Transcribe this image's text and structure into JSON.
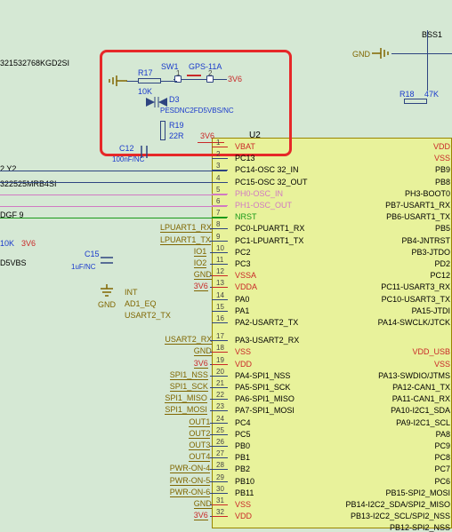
{
  "components": {
    "r17": {
      "ref": "R17",
      "value": "10K"
    },
    "r18": {
      "ref": "R18",
      "value": "47K"
    },
    "r19": {
      "ref": "R19",
      "value": "22R"
    },
    "r_left": {
      "value": "10K"
    },
    "c12": {
      "ref": "C12",
      "value": "100nF/NC"
    },
    "c15": {
      "ref": "C15",
      "value": "1uF/NC"
    },
    "d3": {
      "ref": "D3",
      "value": "PESDNC2FD5VBS/NC"
    },
    "sw1": {
      "ref": "SW1",
      "value": "GPS-11A"
    },
    "u2": {
      "ref": "U2"
    }
  },
  "partial_refs": {
    "top_left": "321532768KGD2SI",
    "y2": "2 Y2",
    "y2_part": "322525MRB4SI",
    "dgf9": "DGF  9",
    "d5vbs": "D5VBS",
    "bss": "BSS1"
  },
  "nets": {
    "gnd": "GND",
    "v3_6": "3V6",
    "int": "INT",
    "ad1_eq": "AD1_EQ",
    "nrst": "NRST"
  },
  "left_netlabels": {
    "lpuart1_rx": "LPUART1_RX",
    "lpuart1_tx": "LPUART1_TX",
    "io1": "IO1",
    "io2": "IO2",
    "usart2_tx": "USART2_TX",
    "usart2_rx": "USART2_RX",
    "spi1_nss": "SPI1_NSS",
    "spi1_sck": "SPI1_SCK",
    "spi1_miso": "SPI1_MISO",
    "spi1_mosi": "SPI1_MOSI",
    "out1": "OUT1",
    "out2": "OUT2",
    "out3": "OUT3",
    "out4": "OUT4",
    "pwr_on4": "PWR-ON-4",
    "pwr_on5": "PWR-ON-5",
    "pwr_on6": "PWR-ON-6"
  },
  "pins": [
    {
      "n": 1,
      "name": "VBAT",
      "cls": "red"
    },
    {
      "n": 2,
      "name": "PC13"
    },
    {
      "n": 3,
      "name": "PC14-OSC 32_IN"
    },
    {
      "n": 4,
      "name": "PC15-OSC 32_OUT"
    },
    {
      "n": 5,
      "name": "PH0-OSC_IN",
      "cls": "pink"
    },
    {
      "n": 6,
      "name": "PH1-OSC_OUT",
      "cls": "pink"
    },
    {
      "n": 7,
      "name": "NRST",
      "cls": "green"
    },
    {
      "n": 8,
      "name": "PC0-LPUART1_RX"
    },
    {
      "n": 9,
      "name": "PC1-LPUART1_TX"
    },
    {
      "n": 10,
      "name": "PC2"
    },
    {
      "n": 11,
      "name": "PC3"
    },
    {
      "n": 12,
      "name": "VSSA",
      "cls": "red"
    },
    {
      "n": 13,
      "name": "VDDA",
      "cls": "red"
    },
    {
      "n": 14,
      "name": "PA0"
    },
    {
      "n": 15,
      "name": "PA1"
    },
    {
      "n": 16,
      "name": "PA2-USART2_TX"
    },
    {
      "n": 17,
      "name": "PA3-USART2_RX"
    },
    {
      "n": 18,
      "name": "VSS",
      "cls": "red"
    },
    {
      "n": 19,
      "name": "VDD",
      "cls": "red"
    },
    {
      "n": 20,
      "name": "PA4-SPI1_NSS"
    },
    {
      "n": 21,
      "name": "PA5-SPI1_SCK"
    },
    {
      "n": 22,
      "name": "PA6-SPI1_MISO"
    },
    {
      "n": 23,
      "name": "PA7-SPI1_MOSI"
    },
    {
      "n": 24,
      "name": "PC4"
    },
    {
      "n": 25,
      "name": "PC5"
    },
    {
      "n": 26,
      "name": "PB0"
    },
    {
      "n": 27,
      "name": "PB1"
    },
    {
      "n": 28,
      "name": "PB2"
    },
    {
      "n": 29,
      "name": "PB10"
    },
    {
      "n": 30,
      "name": "PB11"
    },
    {
      "n": 31,
      "name": "VSS",
      "cls": "red"
    },
    {
      "n": 32,
      "name": "VDD",
      "cls": "red"
    }
  ],
  "right_pins": [
    {
      "name": "VDD",
      "cls": "red"
    },
    {
      "name": "VSS",
      "cls": "red"
    },
    {
      "name": "PB9"
    },
    {
      "name": "PB8"
    },
    {
      "name": "PH3-BOOT0"
    },
    {
      "name": "PB7-USART1_RX"
    },
    {
      "name": "PB6-USART1_TX"
    },
    {
      "name": "PB5"
    },
    {
      "name": "PB4-JNTRST"
    },
    {
      "name": "PB3-JTDO"
    },
    {
      "name": "PD2"
    },
    {
      "name": "PC12"
    },
    {
      "name": "PC11-USART3_RX"
    },
    {
      "name": "PC10-USART3_TX"
    },
    {
      "name": "PA15-JTDI"
    },
    {
      "name": "PA14-SWCLK/JTCK"
    },
    {
      "name": " ",
      "gap": true
    },
    {
      "name": "VDD_USB",
      "cls": "red"
    },
    {
      "name": "VSS",
      "cls": "red"
    },
    {
      "name": "PA13-SWDIO/JTMS"
    },
    {
      "name": "PA12-CAN1_TX"
    },
    {
      "name": "PA11-CAN1_RX"
    },
    {
      "name": "PA10-I2C1_SDA"
    },
    {
      "name": "PA9-I2C1_SCL"
    },
    {
      "name": "PA8"
    },
    {
      "name": "PC9"
    },
    {
      "name": "PC8"
    },
    {
      "name": "PC7"
    },
    {
      "name": "PC6"
    },
    {
      "name": "PB15-SPI2_MOSI"
    },
    {
      "name": "PB14-I2C2_SDA/SPI2_MISO"
    },
    {
      "name": "PB13-I2C2_SCL/SPI2_NSS"
    },
    {
      "name": "PB12-SPI2_NSS"
    }
  ]
}
